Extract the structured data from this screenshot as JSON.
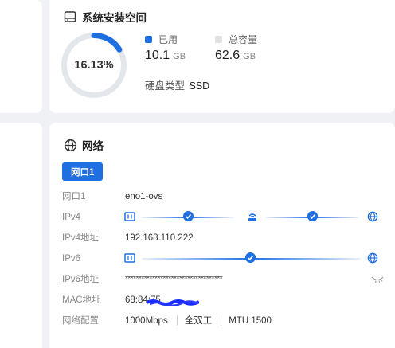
{
  "storage": {
    "title": "系统安装空间",
    "percent_label": "16.13%",
    "percent": 16.13,
    "used_label": "已用",
    "used_value": "10.1",
    "used_unit": "GB",
    "total_label": "总容量",
    "total_value": "62.6",
    "total_unit": "GB",
    "disk_type_label": "硬盘类型",
    "disk_type_value": "SSD",
    "colors": {
      "used": "#1e6fe1",
      "track": "#e3e6ea",
      "total_legend": "#dfe1e5"
    }
  },
  "network": {
    "title": "网络",
    "tab_label": "网口1",
    "rows": {
      "port": {
        "label": "网口1",
        "value": "eno1-ovs"
      },
      "ipv4": {
        "label": "IPv4"
      },
      "ipv4_addr": {
        "label": "IPv4地址",
        "value": "192.168.110.222"
      },
      "ipv6": {
        "label": "IPv6"
      },
      "ipv6_addr": {
        "label": "IPv6地址",
        "value": "************************************"
      },
      "mac": {
        "label": "MAC地址",
        "value": "68:84:75"
      },
      "config": {
        "label": "网络配置",
        "speed": "1000Mbps",
        "duplex": "全双工",
        "mtu": "MTU 1500"
      }
    },
    "icons": [
      "ethernet-port-icon",
      "router-icon",
      "globe-icon",
      "checkmark-icon",
      "eye-closed-icon"
    ],
    "accent": "#1e6fe1"
  }
}
